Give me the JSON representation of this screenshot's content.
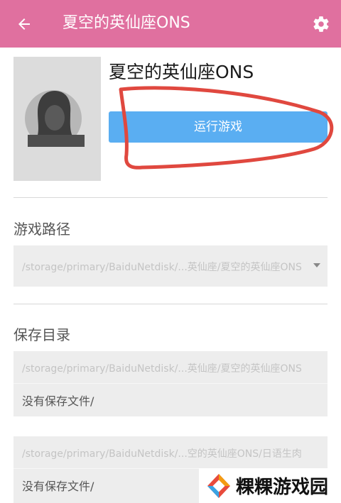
{
  "appbar": {
    "title": "夏空的英仙座ONS",
    "back_icon": "arrow-left-icon",
    "settings_icon": "gear-icon",
    "background": "#e0709f"
  },
  "game": {
    "name": "夏空的英仙座ONS",
    "run_label": "运行游戏",
    "run_color": "#5aaef2"
  },
  "game_path": {
    "label": "游戏路径",
    "value": "/storage/primary/BaiduNetdisk/...英仙座/夏空的英仙座ONS"
  },
  "save_dir": {
    "label": "保存目录",
    "entries": [
      {
        "path": "/storage/primary/BaiduNetdisk/...英仙座/夏空的英仙座ONS",
        "status": "没有保存文件/"
      },
      {
        "path": "/storage/primary/BaiduNetdisk/...空的英仙座ONS/日语生肉",
        "status": "没有保存文件/"
      }
    ]
  },
  "watermark": {
    "text": "粿粿游戏园"
  },
  "annotation": {
    "color": "#e0483f"
  }
}
